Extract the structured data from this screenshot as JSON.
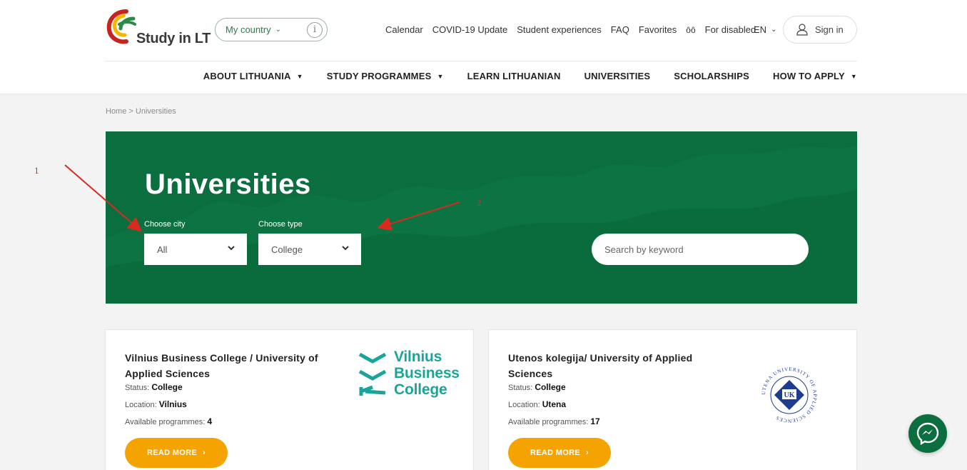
{
  "header": {
    "logo_text": "Study in LT",
    "country_label": "My country",
    "country_info": "i",
    "links": [
      "Calendar",
      "COVID-19 Update",
      "Student experiences",
      "FAQ",
      "Favorites"
    ],
    "accessibility_label": "For disabled",
    "language": "EN",
    "signin_label": "Sign in"
  },
  "nav": {
    "items": [
      {
        "label": "ABOUT LITHUANIA",
        "has_dropdown": true
      },
      {
        "label": "STUDY PROGRAMMES",
        "has_dropdown": true
      },
      {
        "label": "LEARN LITHUANIAN",
        "has_dropdown": false
      },
      {
        "label": "UNIVERSITIES",
        "has_dropdown": false
      },
      {
        "label": "SCHOLARSHIPS",
        "has_dropdown": false
      },
      {
        "label": "HOW TO APPLY",
        "has_dropdown": true
      }
    ]
  },
  "breadcrumb": "Home > Universities",
  "hero": {
    "title": "Universities",
    "city_label": "Choose city",
    "city_value": "All",
    "type_label": "Choose type",
    "type_value": "College",
    "search_placeholder": "Search by keyword"
  },
  "annotations": {
    "one": "1",
    "two": "2"
  },
  "cards": [
    {
      "title": "Vilnius Business College / University of Applied Sciences",
      "status_label": "Status:",
      "status": "College",
      "location_label": "Location:",
      "location": "Vilnius",
      "programmes_label": "Available programmes:",
      "programmes": "4",
      "button": "READ MORE",
      "logo_lines": [
        "Vilnius",
        "Business",
        "College"
      ]
    },
    {
      "title": "Utenos kolegija/ University of Applied Sciences",
      "status_label": "Status:",
      "status": "College",
      "location_label": "Location:",
      "location": "Utena",
      "programmes_label": "Available programmes:",
      "programmes": "17",
      "button": "READ MORE",
      "seal_text": "UTENA UNIVERSITY OF APPLIED SCIENCES",
      "seal_initials": "UK"
    }
  ],
  "colors": {
    "brand_green": "#0b6e3f",
    "accent_orange": "#f5a300",
    "annotation_red": "#d62b1e",
    "vbc_teal": "#1aa59a"
  }
}
